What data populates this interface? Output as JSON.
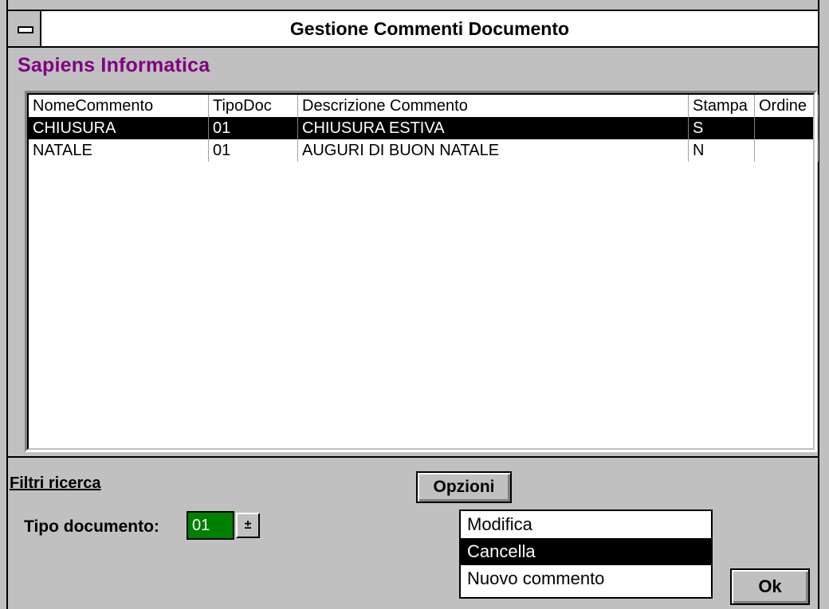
{
  "window": {
    "title": "Gestione Commenti Documento"
  },
  "company": "Sapiens Informatica",
  "grid": {
    "columns": [
      "NomeCommento",
      "TipoDoc",
      "Descrizione Commento",
      "Stampa",
      "Ordine"
    ],
    "rows": [
      {
        "nome": "CHIUSURA",
        "tipo": "01",
        "descrizione": "CHIUSURA ESTIVA",
        "stampa": "S",
        "ordine": ""
      },
      {
        "nome": "NATALE",
        "tipo": "01",
        "descrizione": "AUGURI DI BUON NATALE",
        "stampa": "N",
        "ordine": ""
      }
    ],
    "selected_row": 0
  },
  "filters": {
    "title": "Filtri ricerca",
    "tipo_label": "Tipo documento:",
    "tipo_value": "01",
    "dropdown_glyph": "±"
  },
  "options": {
    "button_label": "Opzioni",
    "menu": [
      "Modifica",
      "Cancella",
      "Nuovo commento"
    ],
    "selected_index": 1
  },
  "ok_label": "Ok",
  "colors": {
    "title_company": "#800080",
    "field_green": "#008000",
    "selection": "#000000",
    "window_bg": "#c0c0c0"
  }
}
